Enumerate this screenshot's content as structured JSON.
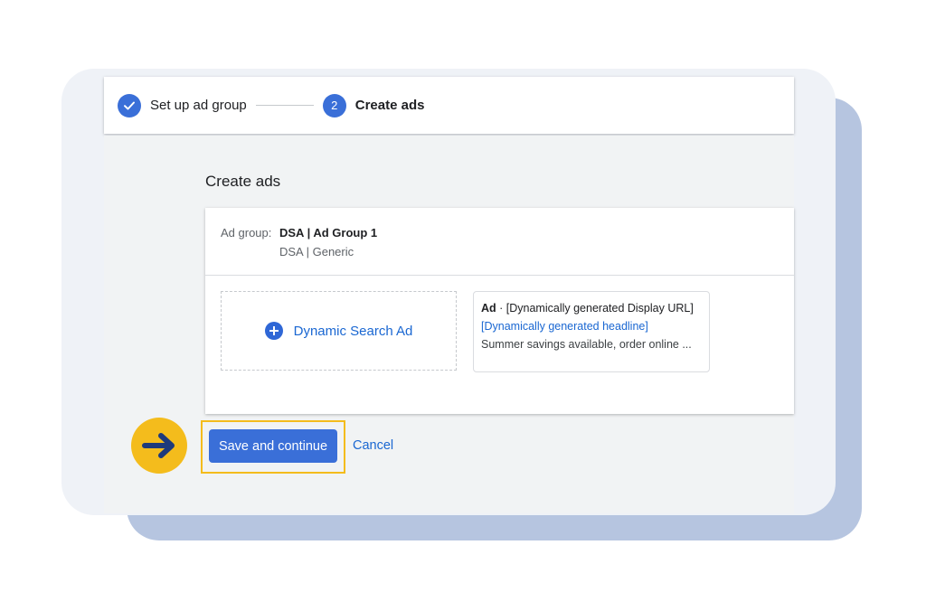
{
  "stepper": {
    "steps": [
      {
        "label": "Set up ad group",
        "state": "completed",
        "icon": "checkmark-icon"
      },
      {
        "number": "2",
        "label": "Create ads",
        "state": "active"
      }
    ]
  },
  "main": {
    "title": "Create ads",
    "ad_group": {
      "label": "Ad group:",
      "name": "DSA | Ad Group 1",
      "campaign": "DSA | Generic"
    },
    "dynamic_search_ad": {
      "label": "Dynamic Search Ad",
      "icon": "plus-circle-icon"
    },
    "ad_preview": {
      "badge": "Ad",
      "separator": " · ",
      "display_url": "[Dynamically generated Display URL]",
      "headline": "[Dynamically generated headline]",
      "description": "Summer savings available, order online ..."
    }
  },
  "actions": {
    "save_label": "Save and continue",
    "cancel_label": "Cancel"
  },
  "colors": {
    "primary": "#3a6fd8",
    "link": "#1a67d2",
    "highlight": "#f4bc1c",
    "arrow": "#1e3a7b",
    "back_card": "#b6c5e0",
    "front_card": "#eff2f7"
  }
}
